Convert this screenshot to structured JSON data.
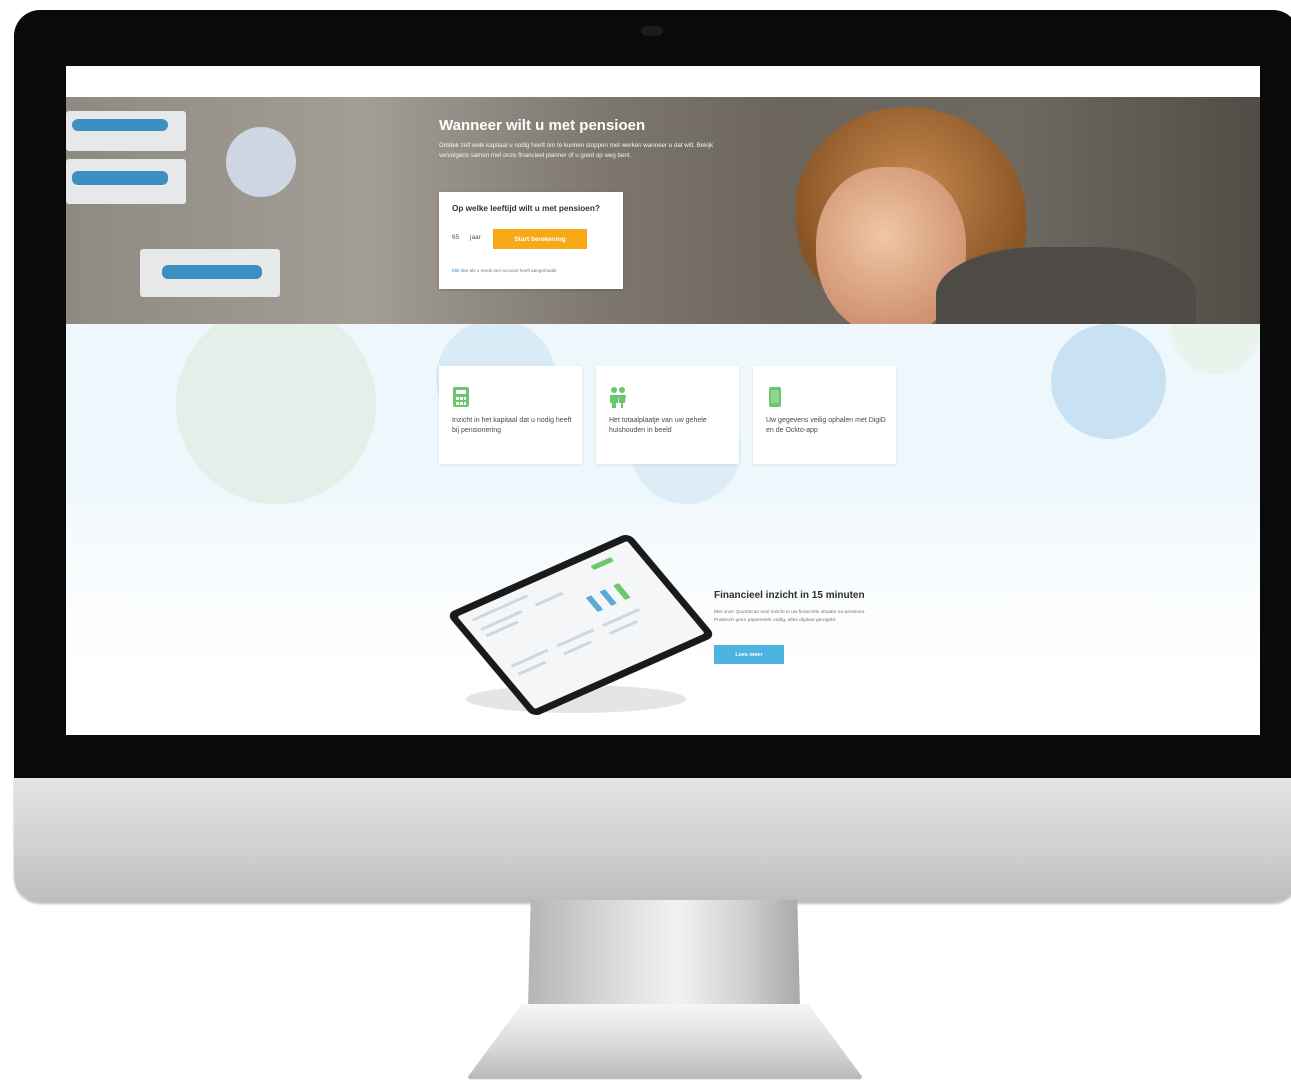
{
  "hero": {
    "title": "Wanneer wilt u met pensioen",
    "intro": "Ontdek zelf welk kapitaal u nodig heeft om te kunnen stoppen met werken wanneer u dat wilt. Bekijk vervolgens samen met onze financieel planner of u goed op weg bent."
  },
  "calculator": {
    "question": "Op welke leeftijd wilt u met pensioen?",
    "age_value": "65",
    "age_unit": "jaar",
    "start_label": "Start berekening",
    "login_link": "Klik hier",
    "login_text": " als u reeds een account heeft aangemaakt"
  },
  "features": [
    {
      "icon": "calculator-icon",
      "text": "Inzicht in het kapitaal dat u nodig heeft bij pensionering"
    },
    {
      "icon": "household-icon",
      "text": "Het totaalplaatje van uw gehele huishouden in beeld"
    },
    {
      "icon": "smartphone-icon",
      "text": "Uw gegevens veilig ophalen met DigiD en de Ockto-app"
    }
  ],
  "promo": {
    "title": "Financieel inzicht in 15 minuten",
    "text": "Met onze QuickScan snel inzicht in uw financiële situatie na pensioen. Praktisch geen papierwerk nodig, alles digitaal geregeld.",
    "button_label": "Lees meer"
  },
  "colors": {
    "accent_orange": "#f6a817",
    "accent_blue": "#4db4e2",
    "icon_green": "#6cc66b",
    "band_background": "#eef7fb"
  }
}
